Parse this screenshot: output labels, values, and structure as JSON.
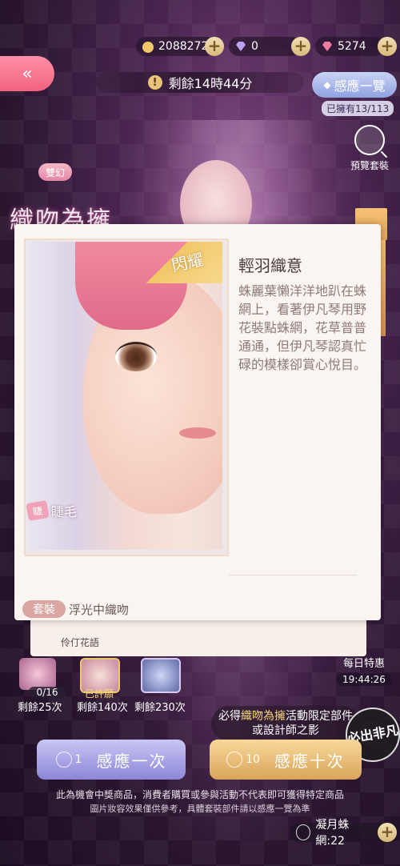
{
  "currency": {
    "gold": {
      "icon": "cat-coin-icon",
      "value": "20882724"
    },
    "diamond": {
      "icon": "diamond-icon",
      "value": "0"
    },
    "pink_diamond": {
      "icon": "pink-diamond-icon",
      "value": "5274"
    }
  },
  "header": {
    "back_icon": "double-chevron-left-icon",
    "timer_icon": "!",
    "timer": "剩餘14時44分",
    "sense_all": "感應一覽",
    "owned": "已擁有13/113",
    "preview": "預覽套裝"
  },
  "event": {
    "badge": "雙幻",
    "title": "織吻為擁"
  },
  "card": {
    "flash_label": "閃耀",
    "part_icon_text": "睫",
    "part_label": "睫毛",
    "item_name": "輕羽織意",
    "item_desc": "蛛麗葉懶洋洋地趴在蛛網上，看著伊凡琴用野花裝點蛛網，花草普普通通，但伊凡琴認真忙碌的模樣卻賞心悅目。",
    "suit_tag": "套裝",
    "suit_name": "浮光中織吻",
    "back_text": "伶仃花語"
  },
  "rewards": [
    {
      "label": "0/16",
      "remaining": "剩餘25次"
    },
    {
      "label": "已許願",
      "remaining": "剩餘140次"
    },
    {
      "label": "",
      "remaining": "剩餘230次"
    }
  ],
  "daily": {
    "label": "每日特惠",
    "time": "19:44:26"
  },
  "bubble": {
    "line1_pre": "必得",
    "line1_hl": "織吻為擁",
    "line1_post": "活動限定部件",
    "line2": "或設計師之影"
  },
  "stamp": "必出非凡",
  "buttons": {
    "once_count": "1",
    "once_label": "感應一次",
    "ten_count": "10",
    "ten_label": "感應十次"
  },
  "disclaimer": {
    "line1": "此為機會中獎商品，消費者購買或參與活動不代表即可獲得特定商品",
    "line2": "圖片妝容效果僅供參考，具體套裝部件請以感應一覽為準"
  },
  "web_item": {
    "label": "凝月蛛網:22"
  },
  "colors": {
    "accent_pink": "#f0627f",
    "gold": "#d9a45a",
    "lavender": "#8c86d6"
  }
}
